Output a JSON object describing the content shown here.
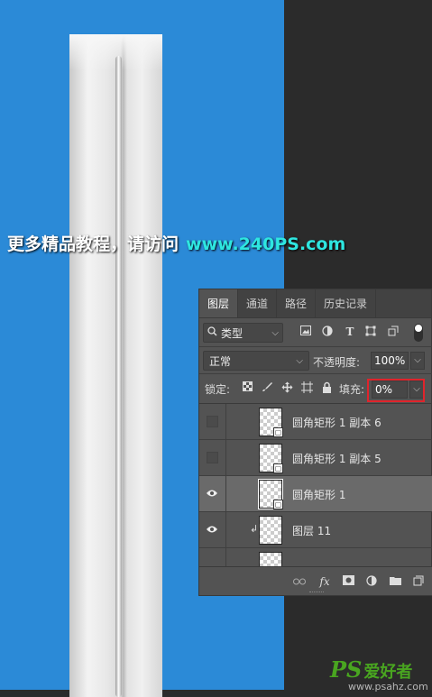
{
  "watermark": {
    "text": "更多精品教程，请访问",
    "url": "www.240PS.com"
  },
  "layers_panel": {
    "tabs": [
      "图层",
      "通道",
      "路径",
      "历史记录"
    ],
    "active_tab": "图层",
    "filter": {
      "icon": "search-icon",
      "value": "类型",
      "filter_icons": [
        "image-filter-icon",
        "adjustment-filter-icon",
        "type-filter-icon",
        "shape-filter-icon",
        "smart-object-filter-icon"
      ]
    },
    "blend_mode": "正常",
    "opacity_label": "不透明度:",
    "opacity_value": "100%",
    "lock_label": "锁定:",
    "fill_label": "填充:",
    "fill_value": "0%",
    "highlight_color": "#e0242c",
    "layers": [
      {
        "name": "圆角矩形 1 副本 6",
        "visible": false,
        "selected": false,
        "shape": true
      },
      {
        "name": "圆角矩形 1 副本 5",
        "visible": false,
        "selected": false,
        "shape": true
      },
      {
        "name": "圆角矩形 1",
        "visible": true,
        "selected": true,
        "shape": true
      },
      {
        "name": "图层 11",
        "visible": true,
        "selected": false,
        "clipped": true,
        "shape": false
      }
    ],
    "bottom_icons": [
      "link-icon",
      "fx-icon",
      "mask-icon",
      "adjustment-icon",
      "folder-icon",
      "new-layer-icon"
    ],
    "fx_label": "fx"
  },
  "logo": {
    "ps": "PS",
    "cn": "爱好者",
    "site": "www.psahz.com"
  },
  "colors": {
    "canvas_bg": "#2b8ad7",
    "panel_bg": "#535353"
  }
}
